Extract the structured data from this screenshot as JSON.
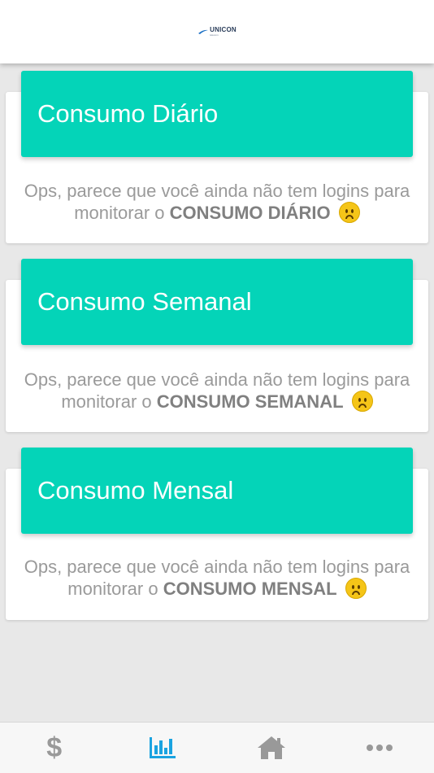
{
  "header": {
    "logo_text": "UNICON",
    "logo_tagline": "telecom"
  },
  "cards": [
    {
      "title": "Consumo Diário",
      "message_prefix": "Ops, parece que você ainda não tem logins para monitorar o",
      "message_bold": "CONSUMO DIÁRIO"
    },
    {
      "title": "Consumo Semanal",
      "message_prefix": "Ops, parece que você ainda não tem logins para monitorar o",
      "message_bold": "CONSUMO SEMANAL"
    },
    {
      "title": "Consumo Mensal",
      "message_prefix": "Ops, parece que você ainda não tem logins para monitorar o",
      "message_bold": "CONSUMO MENSAL"
    }
  ],
  "tabbar": {
    "items": [
      {
        "icon": "dollar-icon",
        "active": false
      },
      {
        "icon": "bar-chart-icon",
        "active": true
      },
      {
        "icon": "home-icon",
        "active": false
      },
      {
        "icon": "more-icon",
        "active": false
      }
    ],
    "active_color": "#1aa3e0",
    "inactive_color": "#999999"
  },
  "colors": {
    "accent": "#04d4b8",
    "background": "#e8e8e8"
  }
}
